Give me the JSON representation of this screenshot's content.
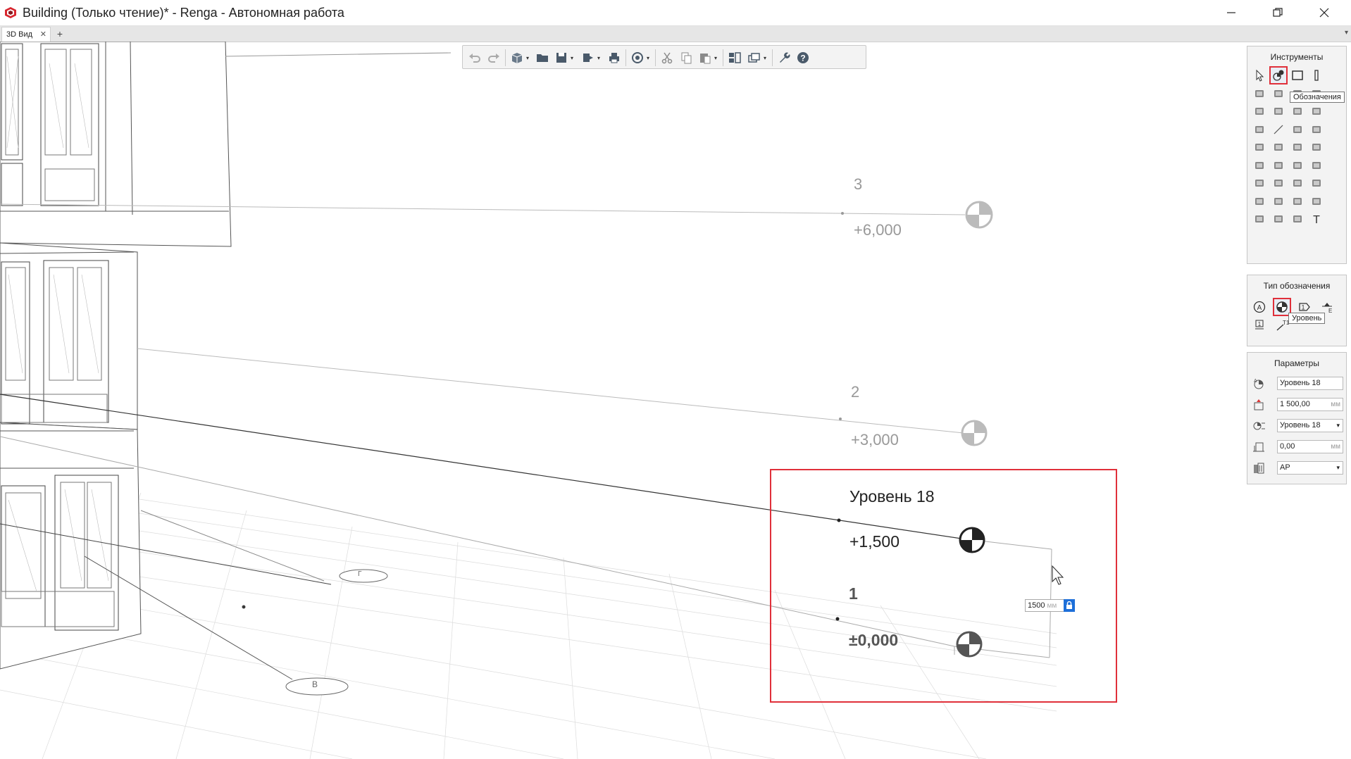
{
  "window": {
    "title": "Building (Только чтение)* - Renga - Автономная работа",
    "minimize_glyph": "—",
    "maximize_glyph": "❐",
    "close_glyph": "✕"
  },
  "tabs": {
    "items": [
      {
        "label": "3D Вид",
        "close": "✕"
      }
    ],
    "add": "+",
    "dropdown": "▾"
  },
  "toolbar": {
    "dropdown_glyph": "▾",
    "icons": [
      "undo-icon",
      "redo-icon",
      "view-cube-icon",
      "open-folder-icon",
      "save-icon",
      "export-icon",
      "print-icon",
      "orbit-icon",
      "cut-icon",
      "copy-icon",
      "paste-icon",
      "split-view-icon",
      "visibility-icon",
      "settings-wrench-icon",
      "help-icon"
    ]
  },
  "tools_panel": {
    "title": "Инструменты",
    "tooltip": "Обозначения",
    "selected": "annotations-tool-icon"
  },
  "annotation_type_panel": {
    "title": "Тип обозначения",
    "tooltip": "Уровень",
    "selected": "level-type-icon"
  },
  "parameters_panel": {
    "title": "Параметры",
    "fields": [
      {
        "value": "Уровень 18",
        "unit": "",
        "dropdown": ""
      },
      {
        "value": "1 500,00",
        "unit": "мм",
        "dropdown": ""
      },
      {
        "value": "Уровень 18",
        "unit": "",
        "dropdown": "▾"
      },
      {
        "value": "0,00",
        "unit": "мм",
        "dropdown": ""
      },
      {
        "value": "АР",
        "unit": "",
        "dropdown": "▾"
      }
    ]
  },
  "levels": [
    {
      "name": "3",
      "elevation": "+6,000"
    },
    {
      "name": "2",
      "elevation": "+3,000"
    },
    {
      "name": "Уровень 18",
      "elevation": "+1,500"
    },
    {
      "name": "1",
      "elevation": "±0,000"
    }
  ],
  "dim_input": {
    "value": "1500",
    "unit": "мм"
  },
  "axes": [
    {
      "label": "Г"
    },
    {
      "label": "В"
    }
  ],
  "colors": {
    "accent_red": "#e0303a",
    "lock_blue": "#1d6fd9"
  }
}
